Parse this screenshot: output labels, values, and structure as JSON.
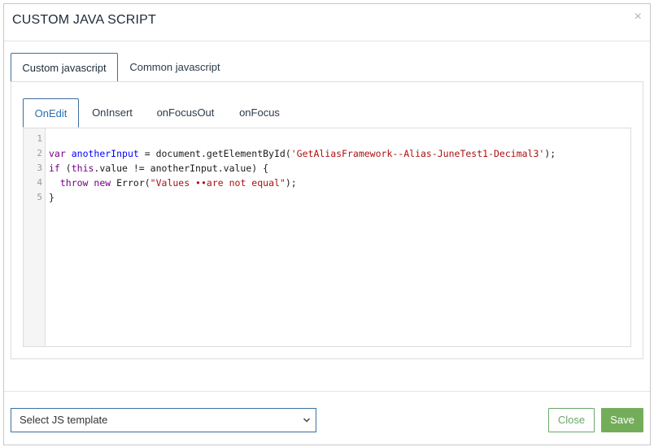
{
  "modal": {
    "title": "CUSTOM JAVA SCRIPT",
    "close_glyph": "×"
  },
  "outer_tabs": [
    {
      "label": "Custom javascript",
      "active": true
    },
    {
      "label": "Common javascript",
      "active": false
    }
  ],
  "inner_tabs": [
    {
      "label": "OnEdit",
      "active": true
    },
    {
      "label": "OnInsert",
      "active": false
    },
    {
      "label": "onFocusOut",
      "active": false
    },
    {
      "label": "onFocus",
      "active": false
    }
  ],
  "editor": {
    "line_numbers": [
      "1",
      "2",
      "3",
      "4",
      "5"
    ],
    "lines": {
      "l2": {
        "kw": "var",
        "sp1": " ",
        "name": "anotherInput",
        "mid": " = document.getElementById(",
        "str": "'GetAliasFramework--Alias-JuneTest1-Decimal3'",
        "end": ");"
      },
      "l3": {
        "kw": "if",
        "open": " (",
        "this": "this",
        "rest": ".value != anotherInput.value) {"
      },
      "l4": {
        "indent": "  ",
        "kw1": "throw",
        "sp": " ",
        "kw2": "new",
        "mid": " Error(",
        "str": "\"Values ••are not equal\"",
        "end": ");"
      },
      "l5": "}"
    }
  },
  "footer": {
    "template_select": "Select JS template",
    "close_label": "Close",
    "save_label": "Save"
  },
  "colors": {
    "accent": "#3c6fa0",
    "save_green": "#74ad5a",
    "keyword": "#770088",
    "variable": "#0000ff",
    "string": "#aa1111"
  },
  "icons": {
    "close": "close-icon",
    "select_caret": "chevron-down-icon"
  }
}
